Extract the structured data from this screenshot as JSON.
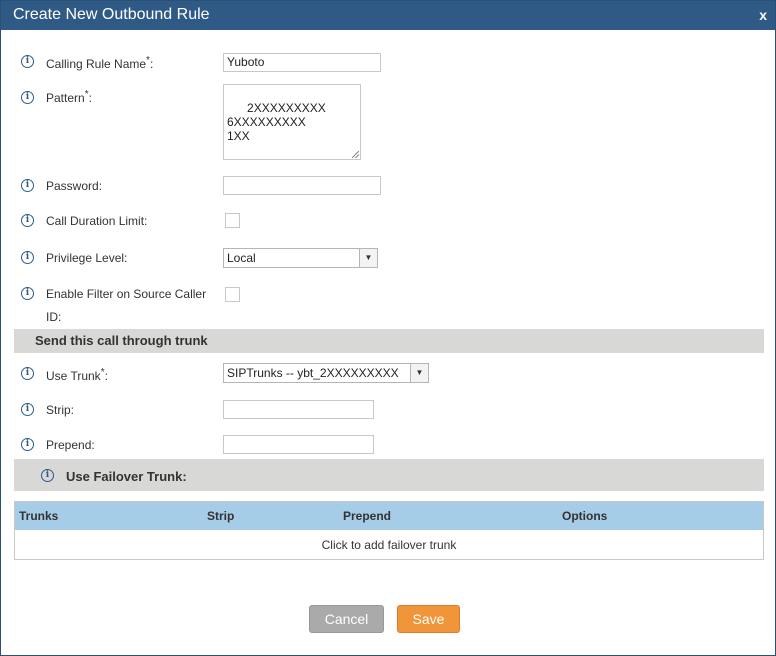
{
  "dialog": {
    "title": "Create New Outbound Rule",
    "close_label": "x"
  },
  "form": {
    "calling_rule_name": {
      "label": "Calling Rule Name",
      "required_mark": "*",
      "suffix": ":",
      "value": "Yuboto"
    },
    "pattern": {
      "label": "Pattern",
      "required_mark": "*",
      "suffix": ":",
      "value": "2XXXXXXXXX\n6XXXXXXXXX\n1XX"
    },
    "password": {
      "label": "Password:",
      "value": ""
    },
    "call_duration_limit": {
      "label": "Call Duration Limit:",
      "checked": false
    },
    "privilege_level": {
      "label": "Privilege Level:",
      "selected": "Local"
    },
    "enable_filter": {
      "label_line1": "Enable Filter on Source Caller",
      "label_line2": "ID:",
      "checked": false
    }
  },
  "trunk_section": {
    "title": "Send this call through trunk",
    "use_trunk": {
      "label": "Use Trunk",
      "required_mark": "*",
      "suffix": ":",
      "selected": "SIPTrunks -- ybt_2XXXXXXXXX"
    },
    "strip": {
      "label": "Strip:",
      "value": ""
    },
    "prepend": {
      "label": "Prepend:",
      "value": ""
    }
  },
  "failover_section": {
    "title": "Use Failover Trunk:",
    "table": {
      "columns": [
        "Trunks",
        "Strip",
        "Prepend",
        "Options"
      ],
      "empty_text": "Click to add failover trunk"
    }
  },
  "buttons": {
    "cancel": "Cancel",
    "save": "Save"
  },
  "colors": {
    "titlebar": "#2e5a85",
    "save_button": "#f1953a",
    "cancel_button": "#aaaaaa",
    "table_header": "#a6cde8",
    "section_bar": "#d8d8d6"
  },
  "icons": {
    "info": "i"
  }
}
